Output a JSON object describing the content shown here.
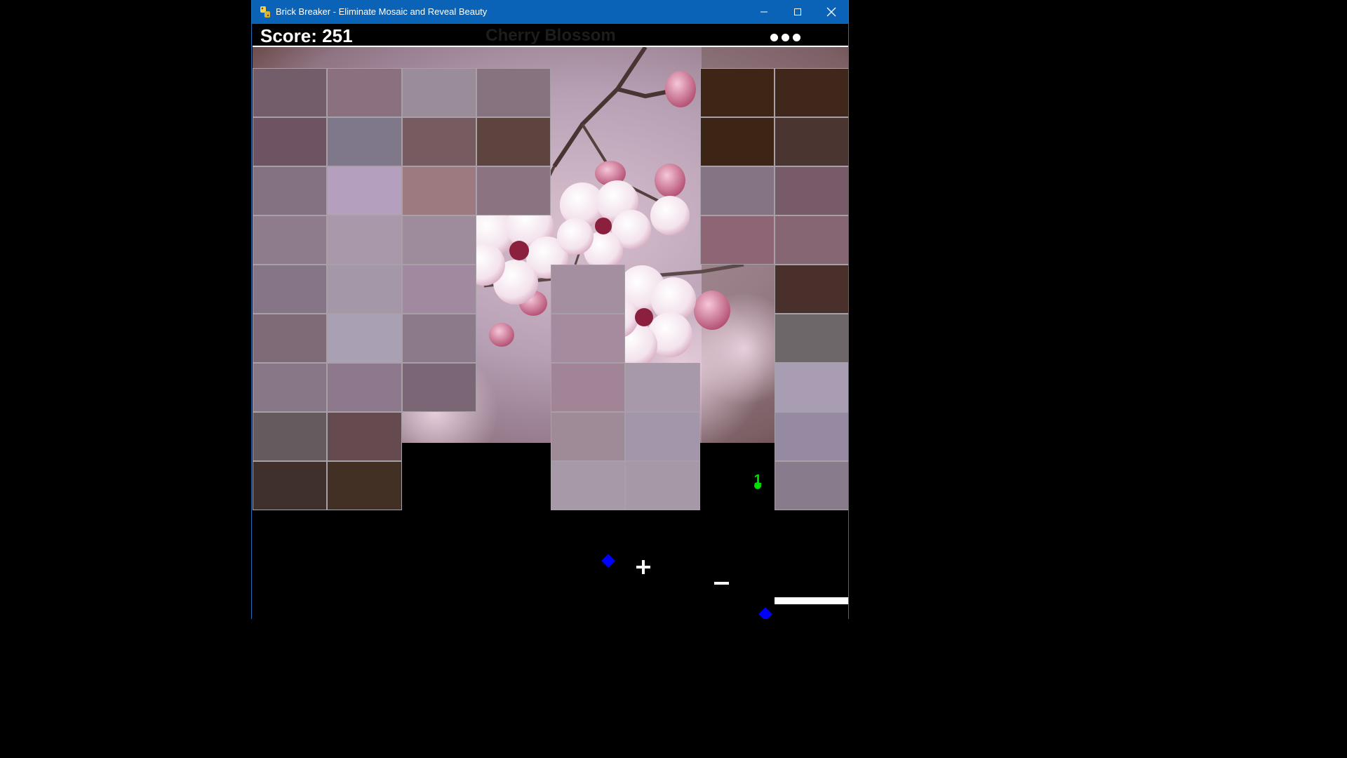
{
  "window": {
    "title": "Brick Breaker - Eliminate Mosaic and Reveal Beauty",
    "accent": "#0a63b6"
  },
  "hud": {
    "score_text": "Score: 251",
    "level_name": "Cherry Blossom",
    "lives": 3
  },
  "bricks": {
    "columns": 8,
    "rows": 9,
    "cells": [
      [
        "#735d6a",
        "#8b7080",
        "#9b8c9a",
        "#87727f",
        null,
        null,
        "#3e2516",
        "#3f271b"
      ],
      [
        "#6e5463",
        "#7f788a",
        "#765b61",
        "#5d443f",
        null,
        null,
        "#3d2515",
        "#4b3530"
      ],
      [
        "#847282",
        "#b59fbf",
        "#9c7a7f",
        "#8b7382",
        null,
        null,
        "#857583",
        "#785b68"
      ],
      [
        "#8e7b8c",
        "#a898aa",
        "#9e8c9c",
        null,
        null,
        null,
        "#8d6575",
        "#876673"
      ],
      [
        "#857587",
        "#a497a7",
        "#a18a9f",
        null,
        "#a48fa1",
        null,
        null,
        "#4a302a"
      ],
      [
        "#7f6a78",
        "#a9a0b4",
        "#8c7a8b",
        null,
        "#a68b9e",
        null,
        null,
        "#6d6769"
      ],
      [
        "#887787",
        "#8d788d",
        "#7b6676",
        null,
        "#a28497",
        "#a798aa",
        null,
        "#a89db2"
      ],
      [
        "#645b5e",
        "#654b4f",
        null,
        null,
        "#9f8b97",
        "#a496aa",
        null,
        "#958aa1"
      ],
      [
        "#40302b",
        "#433024",
        null,
        null,
        "#a899a8",
        "#a798a7",
        null,
        "#887b8b"
      ]
    ]
  },
  "powerups": {
    "extra_life_label": "1"
  },
  "colors": {
    "background": "#000000",
    "ball": "#0000ff",
    "powerup_green": "#00dd00",
    "paddle": "#ffffff"
  }
}
